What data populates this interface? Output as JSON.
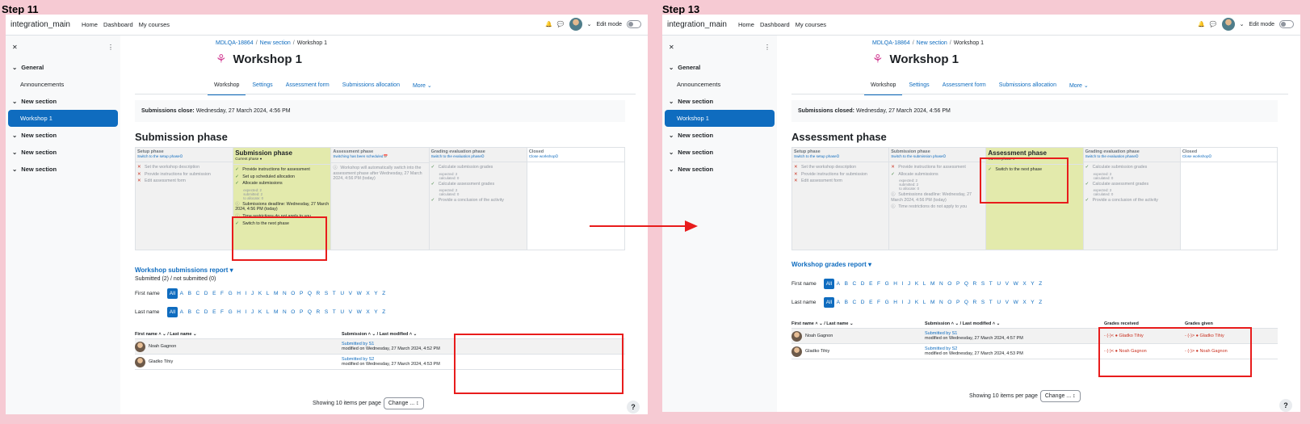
{
  "steps": {
    "left": "Step 11",
    "right": "Step 13"
  },
  "nav": {
    "brand": "integration_main",
    "links": [
      "Home",
      "Dashboard",
      "My courses"
    ],
    "edit_mode": "Edit mode"
  },
  "drawer": {
    "items": [
      {
        "label": "General",
        "type": "section"
      },
      {
        "label": "Announcements",
        "type": "sub"
      },
      {
        "label": "New section",
        "type": "section"
      },
      {
        "label": "Workshop 1",
        "type": "active"
      },
      {
        "label": "New section",
        "type": "section"
      },
      {
        "label": "New section",
        "type": "section"
      },
      {
        "label": "New section",
        "type": "section"
      }
    ]
  },
  "breadcrumb": {
    "course": "MDLQA-18864",
    "section": "New section",
    "current": "Workshop 1"
  },
  "page_title": "Workshop 1",
  "tabs": [
    "Workshop",
    "Settings",
    "Assessment form",
    "Submissions allocation",
    "More ⌄"
  ],
  "left": {
    "notice_label": "Submissions close:",
    "notice_value": "Wednesday, 27 March 2024, 4:56 PM",
    "phase_heading": "Submission phase",
    "phases": [
      {
        "name": "Setup phase",
        "switch": "Switch to the setup phase⭘",
        "tasks": [
          {
            "icon": "x",
            "text": "Set the workshop description"
          },
          {
            "icon": "x",
            "text": "Provide instructions for submission"
          },
          {
            "icon": "x",
            "text": "Edit assessment form"
          }
        ]
      },
      {
        "name": "Submission phase",
        "switch": "Current phase ●",
        "tasks": [
          {
            "icon": "ok",
            "text": "Provide instructions for assessment"
          },
          {
            "icon": "ok",
            "text": "Set up scheduled allocation"
          },
          {
            "icon": "ok",
            "text": "Allocate submissions"
          },
          {
            "icon": "",
            "text": "expected: 2"
          },
          {
            "icon": "",
            "text": "submitted: 2"
          },
          {
            "icon": "",
            "text": "to allocate: 0"
          },
          {
            "icon": "info",
            "text": "Submissions deadline: Wednesday, 27 March 2024, 4:56 PM (today)"
          },
          {
            "icon": "info",
            "text": "Time restrictions do not apply to you"
          },
          {
            "icon": "ok",
            "text": "Switch to the next phase"
          }
        ]
      },
      {
        "name": "Assessment phase",
        "switch": "Switching has been scheduled📅",
        "tasks": [
          {
            "icon": "info",
            "text": "Workshop will automatically switch into the assessment phase after Wednesday, 27 March 2024, 4:56 PM (today)"
          }
        ]
      },
      {
        "name": "Grading evaluation phase",
        "switch": "Switch to the evaluation phase⭘",
        "tasks": [
          {
            "icon": "ok",
            "text": "Calculate submission grades"
          },
          {
            "icon": "",
            "text": "expected: 2"
          },
          {
            "icon": "",
            "text": "calculated: 0"
          },
          {
            "icon": "ok",
            "text": "Calculate assessment grades"
          },
          {
            "icon": "",
            "text": "expected: 2"
          },
          {
            "icon": "",
            "text": "calculated: 0"
          },
          {
            "icon": "ok",
            "text": "Provide a conclusion of the activity"
          }
        ]
      },
      {
        "name": "Closed",
        "switch": "Close workshop⭘",
        "tasks": []
      }
    ],
    "report_title": "Workshop submissions report ▾",
    "report_sub": "Submitted (2) / not submitted (0)",
    "rows": [
      {
        "first": "Noah",
        "last": "Gagnon",
        "name": "Noah Gagnon",
        "sub": "Submitted by S1",
        "mod": "modified on Wednesday, 27 March 2024, 4:52 PM"
      },
      {
        "first": "Gladko",
        "last": "Tihiy",
        "name": "Gladko Tihiy",
        "sub": "Submitted by S2",
        "mod": "modified on Wednesday, 27 March 2024, 4:53 PM"
      }
    ]
  },
  "right": {
    "notice_label": "Submissions closed:",
    "notice_value": "Wednesday, 27 March 2024, 4:56 PM",
    "phase_heading": "Assessment phase",
    "phases": [
      {
        "name": "Setup phase",
        "switch": "Switch to the setup phase⭘",
        "tasks": [
          {
            "icon": "x",
            "text": "Set the workshop description"
          },
          {
            "icon": "x",
            "text": "Provide instructions for submission"
          },
          {
            "icon": "x",
            "text": "Edit assessment form"
          }
        ]
      },
      {
        "name": "Submission phase",
        "switch": "Switch to the submission phase⭘",
        "tasks": [
          {
            "icon": "x",
            "text": "Provide instructions for assessment"
          },
          {
            "icon": "ok",
            "text": "Allocate submissions"
          },
          {
            "icon": "",
            "text": "expected: 2"
          },
          {
            "icon": "",
            "text": "submitted: 2"
          },
          {
            "icon": "",
            "text": "to allocate: 0"
          },
          {
            "icon": "info",
            "text": "Submissions deadline: Wednesday, 27 March 2024, 4:56 PM (today)"
          },
          {
            "icon": "info",
            "text": "Time restrictions do not apply to you"
          }
        ]
      },
      {
        "name": "Assessment phase",
        "switch": "Current phase ●",
        "tasks": [
          {
            "icon": "ok",
            "text": "Switch to the next phase"
          }
        ]
      },
      {
        "name": "Grading evaluation phase",
        "switch": "Switch to the evaluation phase⭘",
        "tasks": [
          {
            "icon": "ok",
            "text": "Calculate submission grades"
          },
          {
            "icon": "",
            "text": "expected: 2"
          },
          {
            "icon": "",
            "text": "calculated: 0"
          },
          {
            "icon": "ok",
            "text": "Calculate assessment grades"
          },
          {
            "icon": "",
            "text": "expected: 2"
          },
          {
            "icon": "",
            "text": "calculated: 0"
          },
          {
            "icon": "ok",
            "text": "Provide a conclusion of the activity"
          }
        ]
      },
      {
        "name": "Closed",
        "switch": "Close workshop⭘",
        "tasks": []
      }
    ],
    "report_title": "Workshop grades report ▾",
    "rows": [
      {
        "first": "Noah",
        "last": "Gagnon",
        "name": "Noah Gagnon",
        "sub": "Submitted by S1",
        "mod": "modified on Wednesday, 27 March 2024, 4:57 PM",
        "recv": "- (-)< ● Gladko Tihiy",
        "given": "- (-)> ● Gladko Tihiy"
      },
      {
        "first": "Gladko",
        "last": "Tihiy",
        "name": "Gladko Tihiy",
        "sub": "Submitted by S2",
        "mod": "modified on Wednesday, 27 March 2024, 4:53 PM",
        "recv": "- (-)< ● Noah Gagnon",
        "given": "- (-)> ● Noah Gagnon"
      }
    ]
  },
  "filter": {
    "first_label": "First name",
    "last_label": "Last name",
    "letters": [
      "All",
      "A",
      "B",
      "C",
      "D",
      "E",
      "F",
      "G",
      "H",
      "I",
      "J",
      "K",
      "L",
      "M",
      "N",
      "O",
      "P",
      "Q",
      "R",
      "S",
      "T",
      "U",
      "V",
      "W",
      "X",
      "Y",
      "Z"
    ]
  },
  "table_headers": {
    "name": "First name ˄ ⌄ / Last name ⌄",
    "submission": "Submission ˄ ⌄ / Last modified ˄ ⌄",
    "received": "Grades received",
    "given": "Grades given"
  },
  "showing": "Showing 10 items per page",
  "change_btn": "Change ... ↕",
  "help": "?"
}
